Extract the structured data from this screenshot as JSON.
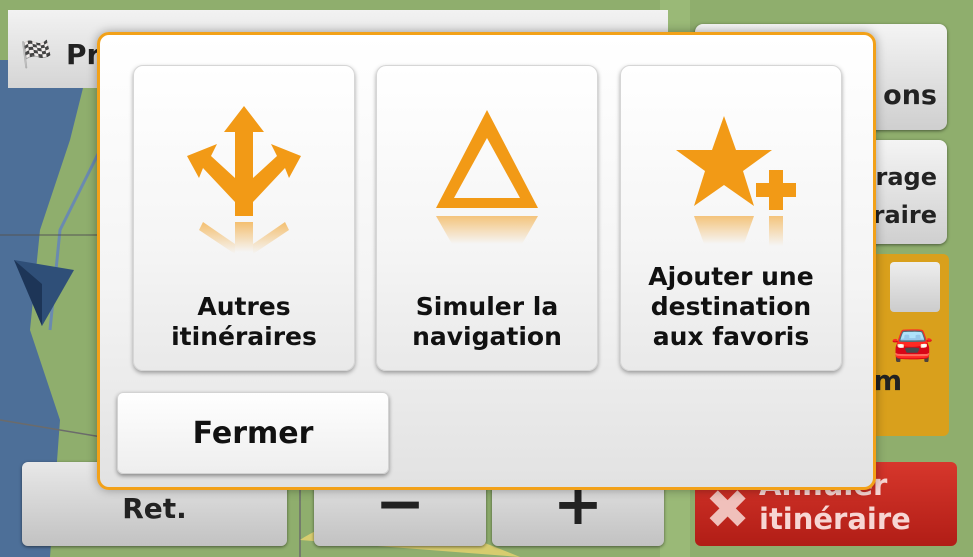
{
  "background": {
    "header_title": "Pr",
    "header_icon": "checkered-flag-icon",
    "side_panel": {
      "options_label": "ons",
      "filter_label_line1": "trage",
      "filter_label_line2": "éraire",
      "route_distance_fragment": "m"
    },
    "bottom_bar": {
      "back_label": "Ret.",
      "zoom_out_label": "−",
      "zoom_in_label": "+",
      "cancel_route_line1": "Annuler",
      "cancel_route_line2": "itinéraire"
    }
  },
  "dialog": {
    "tiles": [
      {
        "icon": "alternative-routes-icon",
        "label_line1": "Autres",
        "label_line2": "itinéraires"
      },
      {
        "icon": "simulate-navigation-icon",
        "label_line1": "Simuler la",
        "label_line2": "navigation"
      },
      {
        "icon": "add-favorite-star-icon",
        "label_line1": "Ajouter une",
        "label_line2": "destination",
        "label_line3": "aux favoris"
      }
    ],
    "close_label": "Fermer"
  },
  "colors": {
    "accent_orange": "#f29a16",
    "dialog_border": "#f2a119",
    "cancel_red": "#c4281f",
    "route_card": "#d9a01c"
  }
}
